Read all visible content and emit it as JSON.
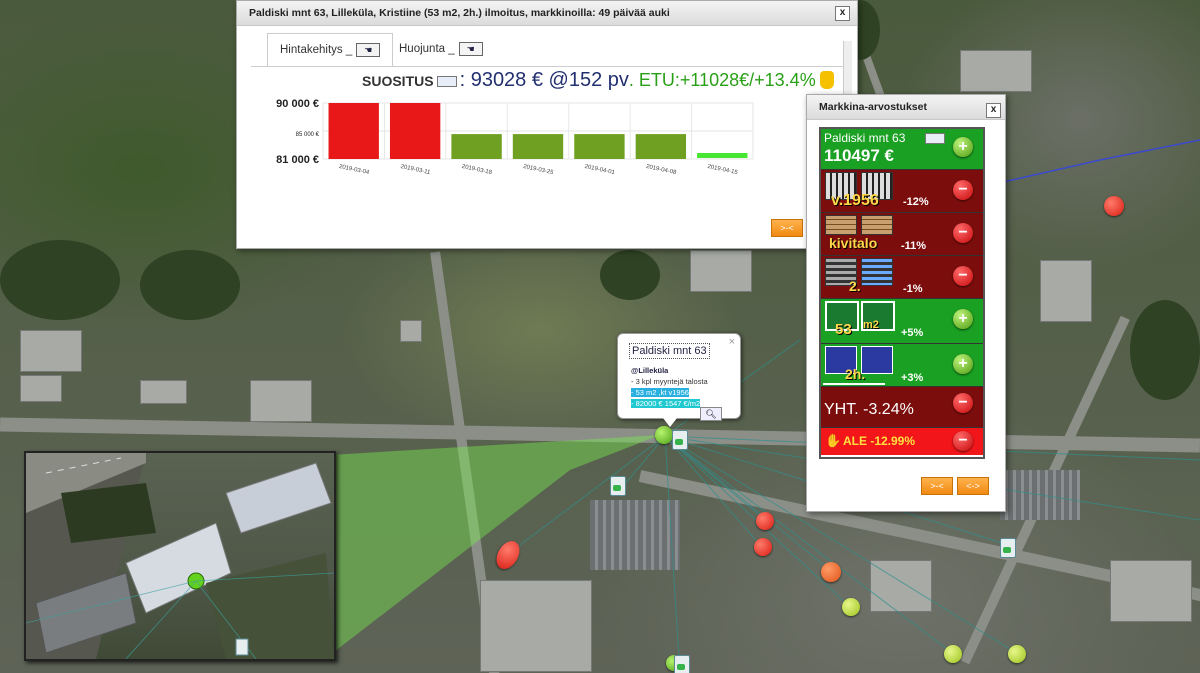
{
  "main_dialog": {
    "title": "Paldiski mnt 63, Lilleküla, Kristiine (53 m2, 2h.) ilmoitus, markkinoilla: 49 päivää auki",
    "close_label": "x",
    "tabs": [
      {
        "label": "Hintakehitys _",
        "icon": "zoom-icon"
      },
      {
        "label": "Huojunta _",
        "icon": "zoom-icon"
      }
    ],
    "summary": {
      "suositus_label": "SUOSITUS",
      "price_text": ": 93028 € @152 pv",
      "etu_text": ". ETU:+11028€/+13.4%",
      "icon": "money-bag-icon"
    },
    "collapse_button": ">-<"
  },
  "chart_data": {
    "type": "bar",
    "categories": [
      "2019-03-04",
      "2019-03-11",
      "2019-03-18",
      "2019-03-25",
      "2019-04-01",
      "2019-04-08",
      "2019-04-15"
    ],
    "values": [
      90000,
      90000,
      85000,
      85000,
      85000,
      85000,
      82000
    ],
    "colors": [
      "#e81818",
      "#e81818",
      "#6fa022",
      "#6fa022",
      "#6fa022",
      "#6fa022",
      "#46e632"
    ],
    "ylim": [
      81000,
      90000
    ],
    "yticks": [
      "90 000 €",
      "85 000 €",
      "81 000 €"
    ],
    "grid": true
  },
  "market_dialog": {
    "title": "Markkina-arvostukset",
    "close_label": "x",
    "address": "Paldiski mnt 63",
    "price": "110497 €",
    "rows": [
      {
        "label": "v.1956",
        "pct": "-12%",
        "sign": "-"
      },
      {
        "label": "kivitalo",
        "pct": "-11%",
        "sign": "-"
      },
      {
        "label": "2.",
        "pct": "-1%",
        "sign": "-"
      },
      {
        "label": "53",
        "sub": "m2",
        "pct": "+5%",
        "sign": "+"
      },
      {
        "label": "2h.",
        "pct": "+3%",
        "sign": "+"
      }
    ],
    "total": "YHT. -3.24%",
    "ale": "ALE -12.99%",
    "buttons": [
      ">-<",
      "<->"
    ]
  },
  "popup": {
    "title": "Paldiski mnt 63",
    "close": "×",
    "area": "@Lilleküla",
    "line1": "- 3 kpl myyntejä talosta",
    "line2": "- 53 m2 ,kt v1956",
    "line3": "- 82000 € 1547 €/m2"
  }
}
